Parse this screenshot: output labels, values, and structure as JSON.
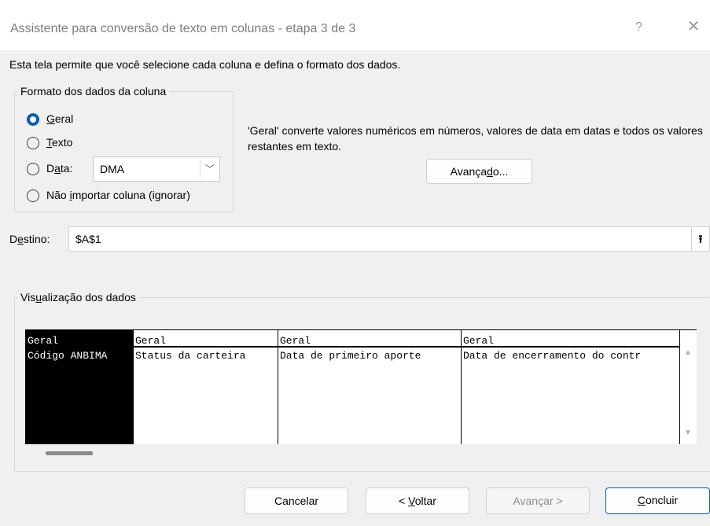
{
  "dialog": {
    "title": "Assistente para conversão de texto em colunas - etapa 3 de 3",
    "help_icon": "?",
    "close_icon": "✕",
    "description": "Esta tela permite que você selecione cada coluna e defina o formato dos dados."
  },
  "format_group": {
    "legend": "Formato dos dados da coluna",
    "options": [
      {
        "prefix": "",
        "mnemonic": "G",
        "rest": "eral",
        "checked": true
      },
      {
        "prefix": "",
        "mnemonic": "T",
        "rest": "exto",
        "checked": false
      },
      {
        "prefix": "D",
        "mnemonic": "a",
        "rest": "ta:",
        "checked": false
      },
      {
        "prefix": "Não ",
        "mnemonic": "i",
        "rest": "mportar coluna (ignorar)",
        "checked": false
      }
    ],
    "date_format": "DMA"
  },
  "info_text": "'Geral' converte valores numéricos em números, valores de data em datas e todos os valores restantes em texto.",
  "advanced_button": {
    "prefix": "Avança",
    "mnemonic": "d",
    "rest": "o..."
  },
  "destination": {
    "prefix": "D",
    "mnemonic": "e",
    "rest": "stino:",
    "value": "$A$1"
  },
  "preview": {
    "legend_prefix": "Vis",
    "legend_mnemonic": "u",
    "legend_rest": "alização dos dados",
    "columns": [
      {
        "header": "Geral",
        "cell": "Código ANBIMA",
        "selected": true
      },
      {
        "header": "Geral",
        "cell": "Status da carteira",
        "selected": false
      },
      {
        "header": "Geral",
        "cell": "Data de primeiro aporte",
        "selected": false
      },
      {
        "header": "Geral",
        "cell": "Data de encerramento do contr",
        "selected": false
      }
    ]
  },
  "buttons": {
    "cancel": "Cancelar",
    "back_prefix": "< ",
    "back_mnemonic": "V",
    "back_rest": "oltar",
    "next": "Avançar >",
    "finish_mnemonic": "C",
    "finish_rest": "oncluir"
  },
  "colors": {
    "accent": "#005fb8",
    "background": "#f0f0f0"
  }
}
